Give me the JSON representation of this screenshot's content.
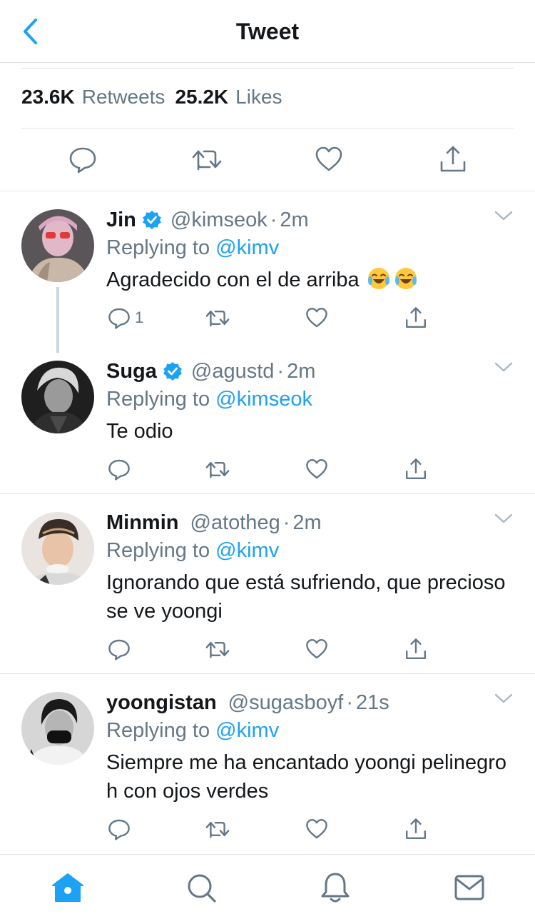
{
  "header": {
    "title": "Tweet",
    "back_icon": "chevron-left-icon"
  },
  "stats": {
    "retweets_count": "23.6K",
    "retweets_label": "Retweets",
    "likes_count": "25.2K",
    "likes_label": "Likes"
  },
  "main_actions": [
    "reply-icon",
    "retweet-icon",
    "like-icon",
    "share-icon"
  ],
  "replies": [
    {
      "name": "Jin",
      "verified": true,
      "handle": "@kimseok",
      "dot": "·",
      "time": "2m",
      "replying_prefix": "Replying to",
      "replying_to": "@kimv",
      "text": "Agradecido con el de arriba",
      "emoji": [
        "joy-emoji",
        "joy-emoji"
      ],
      "reply_count": "1"
    },
    {
      "name": "Suga",
      "verified": true,
      "handle": "@agustd",
      "dot": "·",
      "time": "2m",
      "replying_prefix": "Replying to",
      "replying_to": "@kimseok",
      "text": "Te odio",
      "reply_count": ""
    },
    {
      "name": "Minmin",
      "verified": false,
      "handle": "@atotheg",
      "dot": "·",
      "time": "2m",
      "replying_prefix": "Replying to",
      "replying_to": "@kimv",
      "text": "Ignorando que está sufriendo, que precioso se ve yoongi",
      "reply_count": ""
    },
    {
      "name": "yoongistan",
      "verified": false,
      "handle": "@sugasboyf",
      "dot": "·",
      "time": "21s",
      "replying_prefix": "Replying to",
      "replying_to": "@kimv",
      "text": "Siempre me ha encantado yoongi pelinegro h con ojos verdes",
      "reply_count": ""
    }
  ],
  "tabbar": [
    "home-icon",
    "search-icon",
    "notifications-icon",
    "messages-icon"
  ],
  "colors": {
    "accent": "#1da1f2",
    "secondary_text": "#657786",
    "divider": "#dfe3e6"
  }
}
